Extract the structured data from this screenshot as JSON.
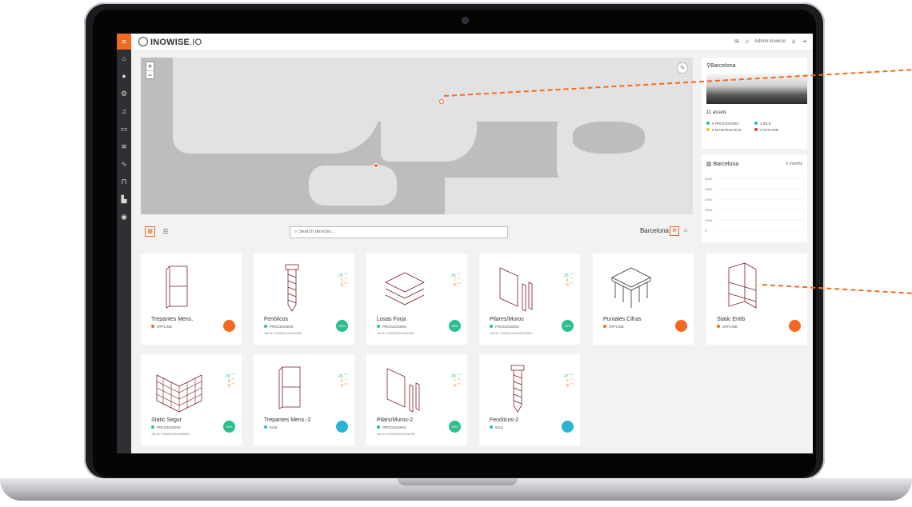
{
  "app": {
    "brand_bold": "INOWISE",
    "brand_light": ".IO"
  },
  "topbar": {
    "user_label": "Admin inowise"
  },
  "sidebar": {
    "menu_icon": "menu-icon",
    "items": [
      "home-icon",
      "globe-icon",
      "settings-icon",
      "bell-icon",
      "inbox-icon",
      "wifi-icon",
      "activity-icon",
      "lock-icon",
      "factory-icon",
      "location-icon"
    ]
  },
  "map": {
    "zoom_in": "+",
    "zoom_out": "−",
    "pin_city": "Barcelona"
  },
  "location_card": {
    "title": "Barcelona",
    "assets": "11 assets",
    "statuses": [
      {
        "label": "6 PROCESSING",
        "color": "#2bbf8a"
      },
      {
        "label": "2 IDLE",
        "color": "#2ab4d8"
      },
      {
        "label": "0 MAINTENANCE",
        "color": "#f5c21b"
      },
      {
        "label": "3 OFFLINE",
        "color": "#e53935"
      }
    ]
  },
  "chart_card": {
    "title": "Barcelona",
    "range": "6 months"
  },
  "chart_data": {
    "type": "line",
    "title": "Barcelona",
    "ylabel": "",
    "xlabel": "",
    "y_ticks": [
      "5000",
      "4000",
      "3000",
      "2000",
      "1000",
      "0"
    ],
    "ylim": [
      0,
      5000
    ],
    "series": [],
    "grid": true
  },
  "toolbar": {
    "search_placeholder": "Search devices...",
    "city": "Barcelona"
  },
  "devices": [
    {
      "name": "Trepantes Mens.",
      "state": "OFFLINE",
      "state_color": "#f26a21",
      "job": "",
      "metrics": [],
      "badge": "",
      "badge_class": "offline",
      "icon": "panel"
    },
    {
      "name": "Fenólicos",
      "state": "PROCESSING",
      "state_color": "#2bbf8a",
      "job": "Job ID: IX2025112410142942",
      "metrics": [
        "26",
        "5",
        "0"
      ],
      "badge": "96%",
      "badge_class": "processing",
      "icon": "screw"
    },
    {
      "name": "Losas Forja",
      "state": "PROCESSING",
      "state_color": "#2bbf8a",
      "job": "Job ID: IX2025112410463611",
      "metrics": [
        "26",
        "7",
        "0"
      ],
      "badge": "33%",
      "badge_class": "processing",
      "icon": "slabs"
    },
    {
      "name": "Pilares/Muros",
      "state": "PROCESSING",
      "state_color": "#2bbf8a",
      "job": "Job ID: IX2025112410162791500",
      "metrics": [
        "26",
        "4",
        "0"
      ],
      "badge": "73%",
      "badge_class": "processing",
      "icon": "pillars"
    },
    {
      "name": "Puntales Cifras",
      "state": "OFFLINE",
      "state_color": "#f26a21",
      "job": "",
      "metrics": [],
      "badge": "",
      "badge_class": "offline",
      "icon": "table"
    },
    {
      "name": "Static Entib",
      "state": "OFFLINE",
      "state_color": "#f26a21",
      "job": "",
      "metrics": [],
      "badge": "",
      "badge_class": "offline",
      "icon": "box"
    },
    {
      "name": "Static Segur",
      "state": "PROCESSING",
      "state_color": "#2bbf8a",
      "job": "Job ID: IX2025112410166055",
      "metrics": [
        "28",
        "8",
        "0"
      ],
      "badge": "94%",
      "badge_class": "processing",
      "icon": "wall"
    },
    {
      "name": "Trepantes Mens.-2",
      "state": "IDLE",
      "state_color": "#2ab4d8",
      "job": "",
      "metrics": [
        "26",
        "4",
        "0"
      ],
      "badge": "",
      "badge_class": "idle",
      "icon": "panel"
    },
    {
      "name": "Pilars/Muros-2",
      "state": "PROCESSING",
      "state_color": "#2bbf8a",
      "job": "Job ID: IX2025112410156755",
      "metrics": [
        "28",
        "7",
        "0"
      ],
      "badge": "65%",
      "badge_class": "processing",
      "icon": "pillars"
    },
    {
      "name": "Fenólicos-2",
      "state": "IDLE",
      "state_color": "#2ab4d8",
      "job": "",
      "metrics": [
        "27",
        "6",
        "0"
      ],
      "badge": "",
      "badge_class": "idle",
      "icon": "screw"
    }
  ]
}
